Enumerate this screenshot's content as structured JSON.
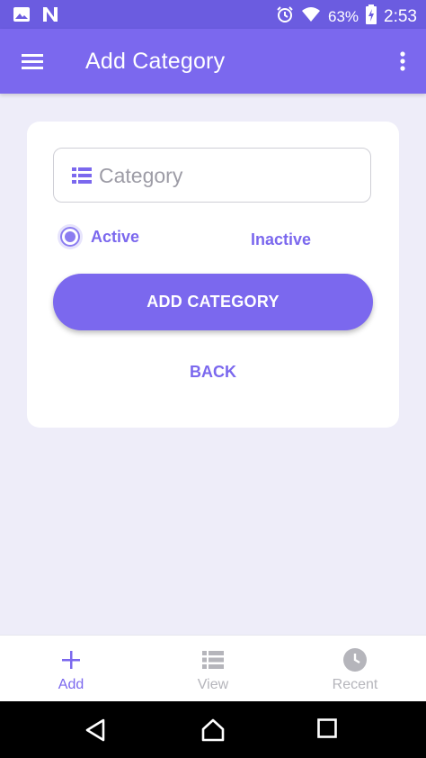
{
  "status_bar": {
    "battery": "63%",
    "time": "2:53",
    "icons": [
      "image-icon",
      "n-icon",
      "alarm-icon",
      "wifi-icon",
      "battery-charging-icon"
    ]
  },
  "app_bar": {
    "title": "Add Category",
    "icons": [
      "hamburger-menu-icon",
      "overflow-menu-icon"
    ]
  },
  "form": {
    "category_placeholder": "Category",
    "category_value": "",
    "status_options": [
      {
        "label": "Active",
        "selected": true
      },
      {
        "label": "Inactive",
        "selected": false
      }
    ],
    "add_button": "ADD CATEGORY",
    "back_button": "BACK"
  },
  "bottom_nav": {
    "items": [
      {
        "label": "Add",
        "icon": "plus-icon",
        "active": true
      },
      {
        "label": "View",
        "icon": "list-icon",
        "active": false
      },
      {
        "label": "Recent",
        "icon": "clock-icon",
        "active": false
      }
    ]
  },
  "colors": {
    "primary": "#7b68ee",
    "status_bar": "#6b5ce0",
    "background": "#eeedf9",
    "inactive_nav": "#b5b5bb"
  }
}
